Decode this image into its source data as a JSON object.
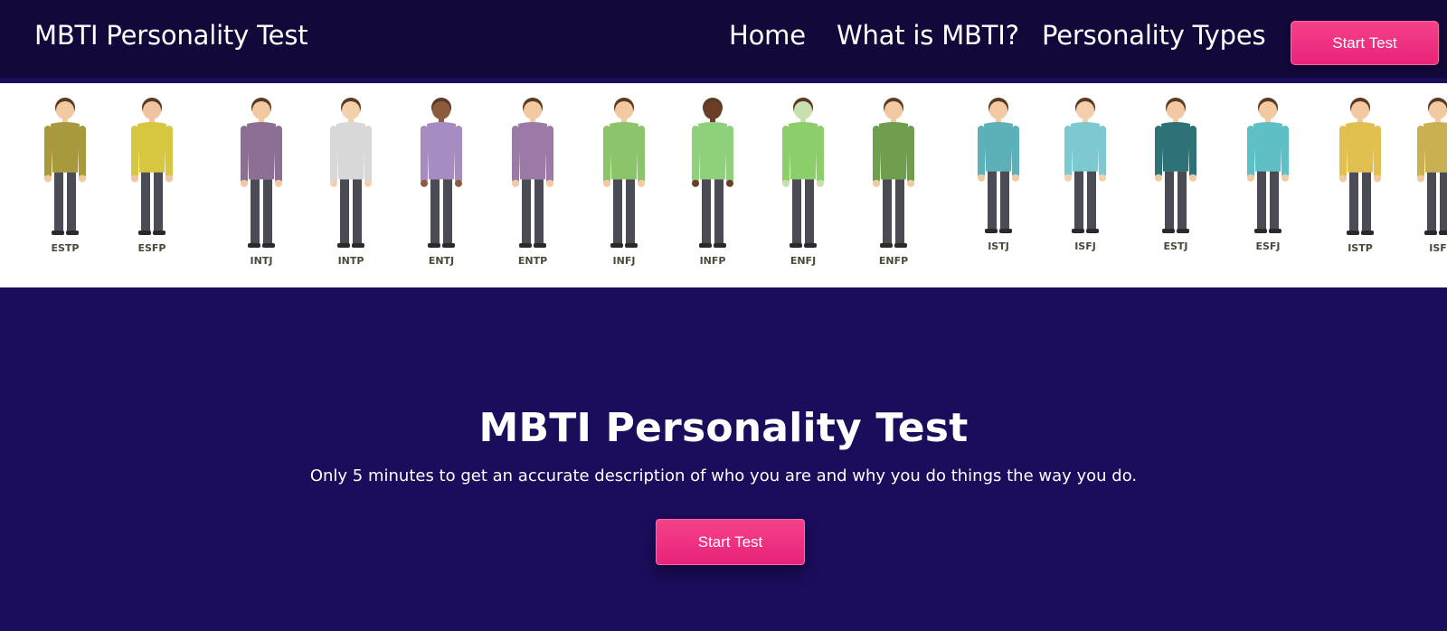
{
  "navbar": {
    "brand": "MBTI Personality Test",
    "links": [
      "Home",
      "What is MBTI?",
      "Personality Types"
    ],
    "cta_label": "Start Test"
  },
  "banner": {
    "characters": [
      {
        "type": "ESTP",
        "color": "#a89a3c"
      },
      {
        "type": "ESFP",
        "color": "#d6c640"
      },
      {
        "type": "INTJ",
        "color": "#8e6f94"
      },
      {
        "type": "INTP",
        "color": "#d8d8d8"
      },
      {
        "type": "ENTJ",
        "color": "#a68cc0"
      },
      {
        "type": "ENTP",
        "color": "#9b7aa8"
      },
      {
        "type": "INFJ",
        "color": "#8bc46a"
      },
      {
        "type": "INFP",
        "color": "#8fd07a"
      },
      {
        "type": "ENFJ",
        "color": "#8ccf6a"
      },
      {
        "type": "ENFP",
        "color": "#6e9e4e"
      },
      {
        "type": "ISTJ",
        "color": "#5cb0b8"
      },
      {
        "type": "ISFJ",
        "color": "#7ccad0"
      },
      {
        "type": "ESTJ",
        "color": "#2e7278"
      },
      {
        "type": "ESFJ",
        "color": "#5ec0c4"
      },
      {
        "type": "ISTP",
        "color": "#e2c050"
      },
      {
        "type": "ISF",
        "color": "#c9b050"
      }
    ]
  },
  "hero": {
    "title": "MBTI Personality Test",
    "subtitle": "Only 5 minutes to get an accurate description of who you are and why you do things the way you do.",
    "cta_label": "Start Test"
  }
}
